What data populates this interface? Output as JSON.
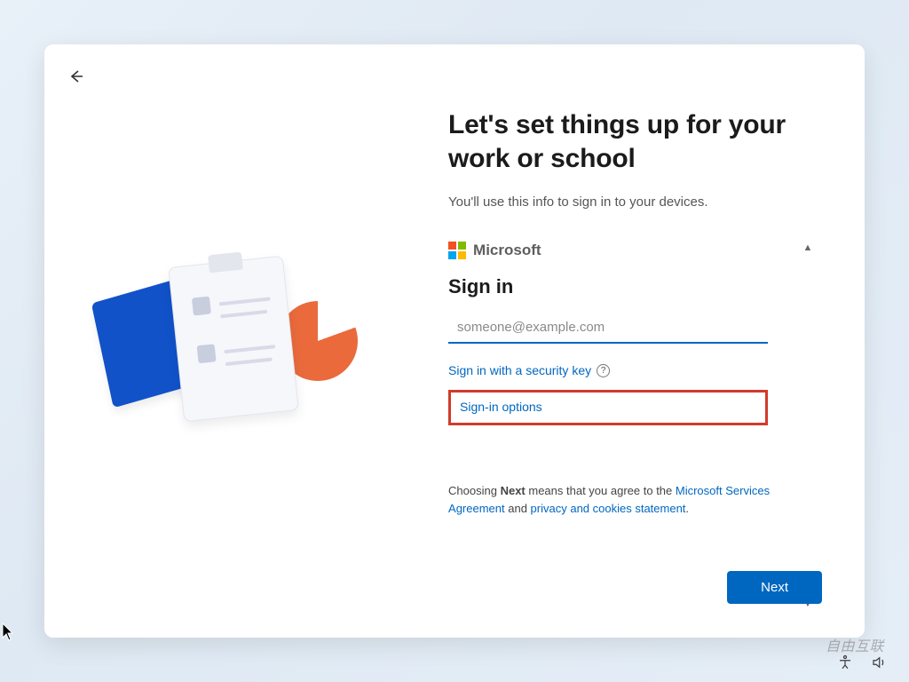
{
  "header": {
    "title": "Let's set things up for your work or school",
    "subtitle": "You'll use this info to sign in to your devices."
  },
  "brand": {
    "name": "Microsoft"
  },
  "signin": {
    "heading": "Sign in",
    "placeholder": "someone@example.com",
    "value": "",
    "security_key_link": "Sign in with a security key",
    "options_link": "Sign-in options"
  },
  "agreement": {
    "prefix": "Choosing ",
    "bold": "Next",
    "middle": " means that you agree to the ",
    "link1": "Microsoft Services Agreement",
    "joiner": " and ",
    "link2": "privacy and cookies statement",
    "suffix": "."
  },
  "buttons": {
    "next": "Next"
  },
  "icons": {
    "back": "back-arrow-icon",
    "help": "?",
    "accessibility": "accessibility-icon",
    "volume": "volume-icon"
  },
  "watermark": "自由互联"
}
